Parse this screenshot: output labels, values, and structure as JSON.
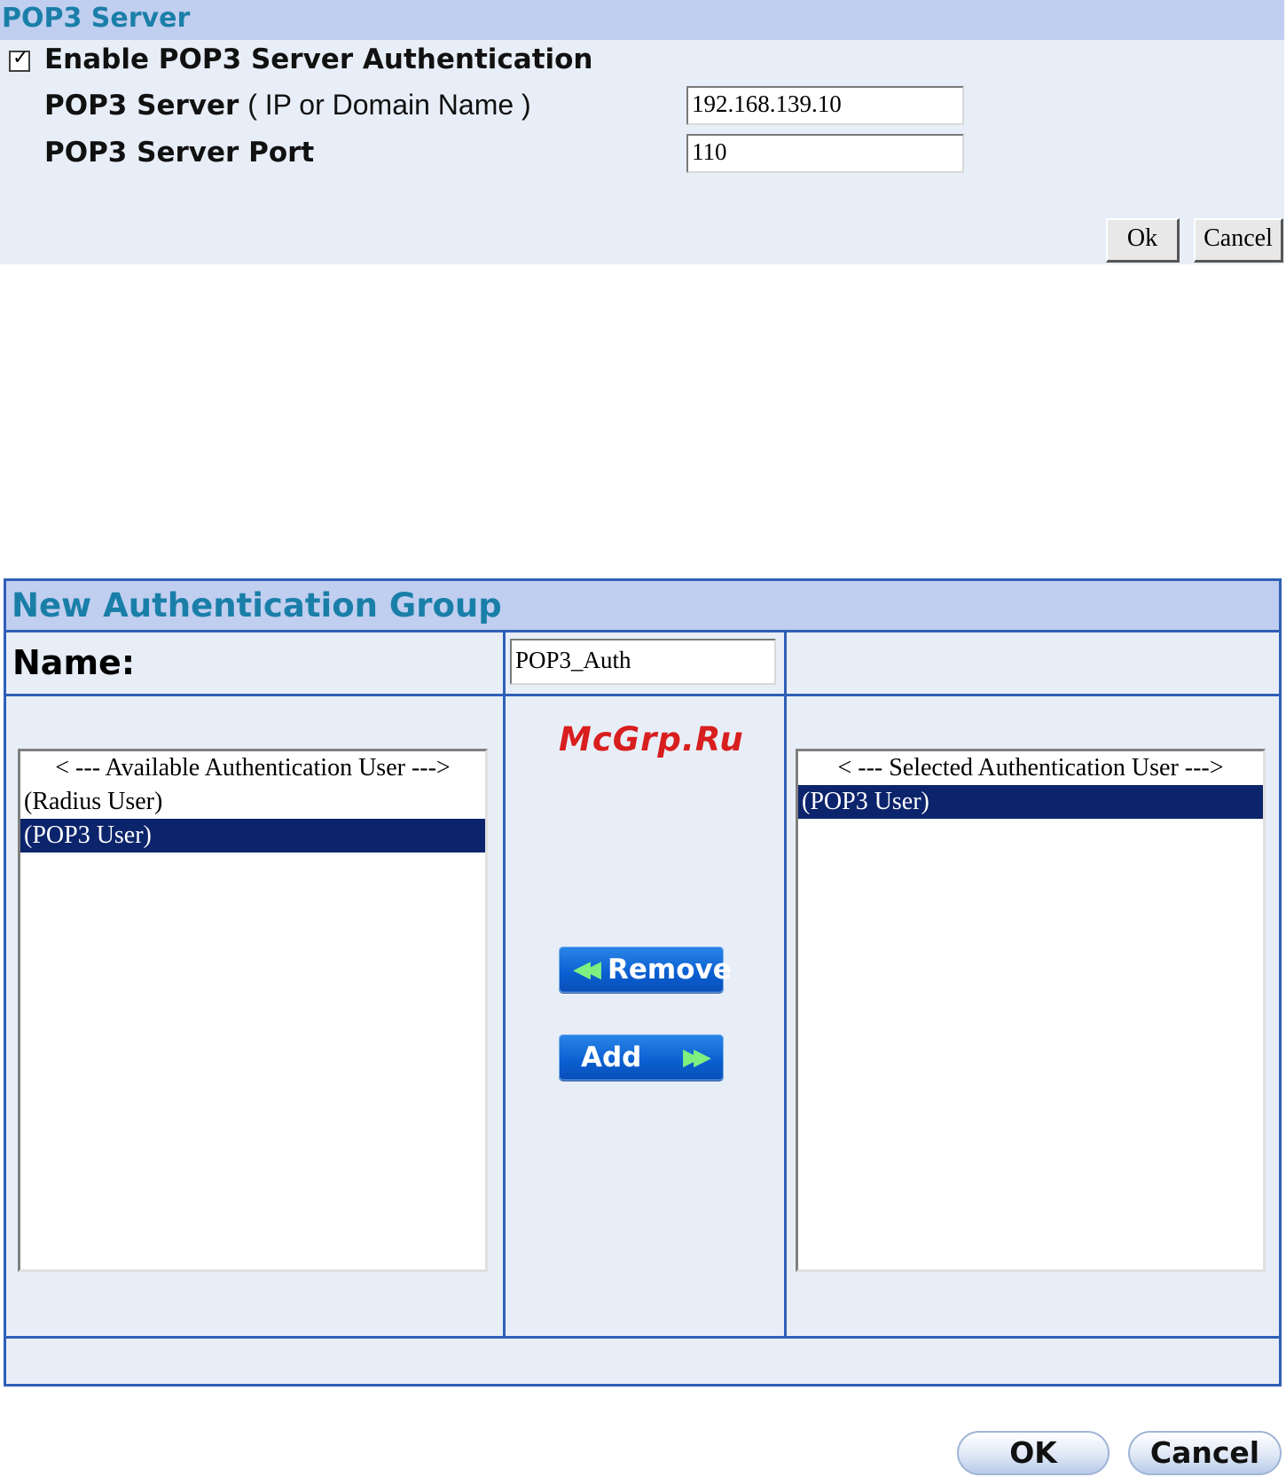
{
  "pop3": {
    "title": "POP3 Server",
    "enable_label": "Enable POP3 Server Authentication",
    "enable_checked": true,
    "server_label": "POP3 Server",
    "server_hint": "( IP or Domain Name )",
    "server_value": "192.168.139.10",
    "port_label": "POP3 Server Port",
    "port_value": "110",
    "ok_label": "Ok",
    "cancel_label": "Cancel"
  },
  "group": {
    "title": "New Authentication Group",
    "name_label": "Name:",
    "name_value": "POP3_Auth",
    "available": {
      "header": "< --- Available Authentication User --->",
      "items": [
        "(Radius User)",
        "(POP3 User)"
      ],
      "selected_index": 1
    },
    "selected": {
      "header": "< --- Selected Authentication User --->",
      "items": [
        "(POP3 User)"
      ],
      "selected_index": 0
    },
    "remove_label": "Remove",
    "add_label": "Add"
  },
  "watermark": "McGrp.Ru",
  "footer": {
    "ok_label": "OK",
    "cancel_label": "Cancel"
  },
  "colors": {
    "header_bg": "#c0cef0",
    "panel_bg": "#e8eef7",
    "title_text": "#1a7fa8",
    "border_blue": "#2f5fb8",
    "selection": "#0c246b",
    "watermark": "#d81e1e"
  }
}
